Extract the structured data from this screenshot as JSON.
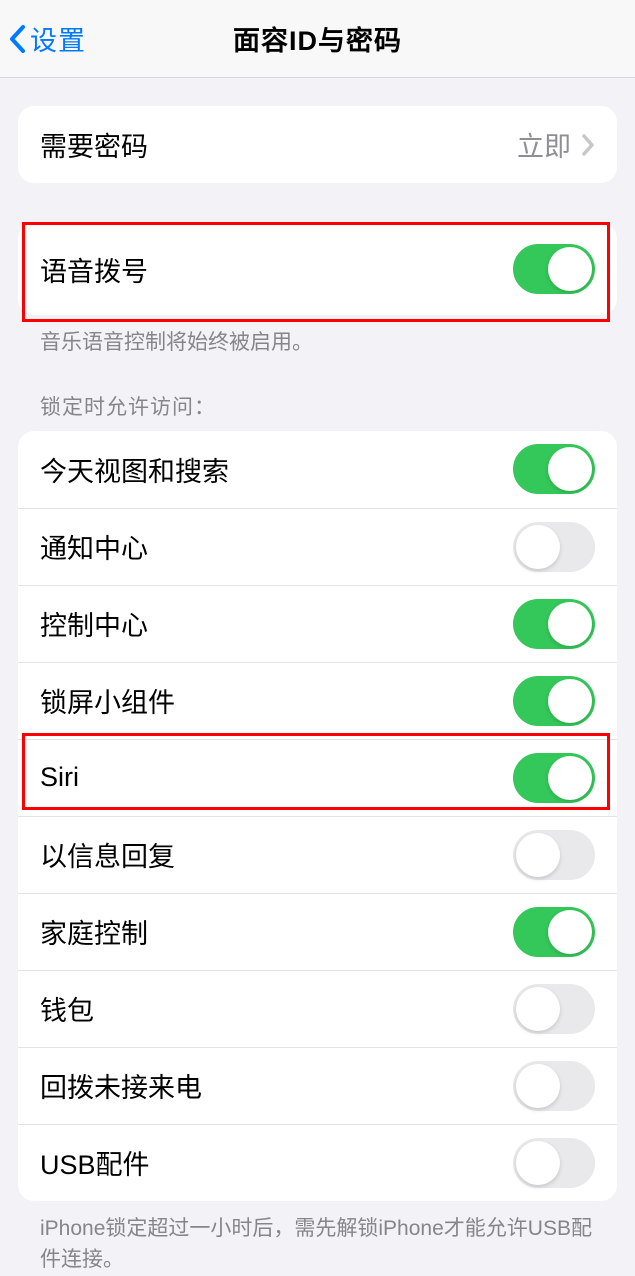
{
  "header": {
    "back_label": "设置",
    "title": "面容ID与密码"
  },
  "require_passcode": {
    "label": "需要密码",
    "value": "立即"
  },
  "voice_dial": {
    "label": "语音拨号",
    "on": true,
    "footer": "音乐语音控制将始终被启用。"
  },
  "lock_access": {
    "header": "锁定时允许访问：",
    "items": [
      {
        "label": "今天视图和搜索",
        "on": true
      },
      {
        "label": "通知中心",
        "on": false
      },
      {
        "label": "控制中心",
        "on": true
      },
      {
        "label": "锁屏小组件",
        "on": true
      },
      {
        "label": "Siri",
        "on": true
      },
      {
        "label": "以信息回复",
        "on": false
      },
      {
        "label": "家庭控制",
        "on": true
      },
      {
        "label": "钱包",
        "on": false
      },
      {
        "label": "回拨未接来电",
        "on": false
      },
      {
        "label": "USB配件",
        "on": false
      }
    ],
    "footer": "iPhone锁定超过一小时后，需先解锁iPhone才能允许USB配件连接。"
  }
}
